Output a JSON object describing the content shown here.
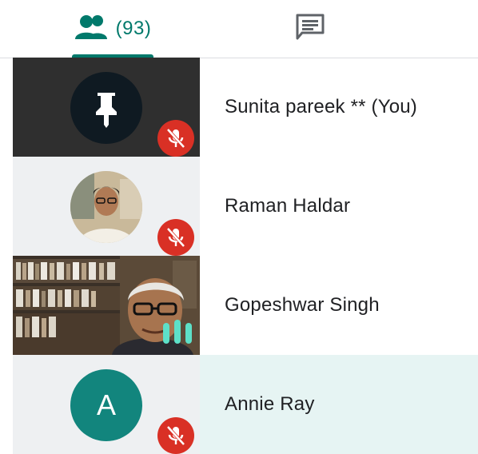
{
  "tabs": {
    "people": {
      "count": "(93)",
      "icon": "people-icon"
    },
    "chat": {
      "icon": "chat-icon"
    }
  },
  "colors": {
    "accent": "#00796b",
    "mute": "#d93025",
    "highlight": "#e6f4f3"
  },
  "participants": [
    {
      "name": "Sunita pareek ** (You)",
      "tile": "pin-avatar",
      "muted": true
    },
    {
      "name": "Raman Haldar",
      "tile": "photo-avatar",
      "muted": true
    },
    {
      "name": "Gopeshwar Singh",
      "tile": "video",
      "speaking": true
    },
    {
      "name": "Annie Ray",
      "tile": "letter-avatar",
      "initial": "A",
      "muted": true
    }
  ]
}
